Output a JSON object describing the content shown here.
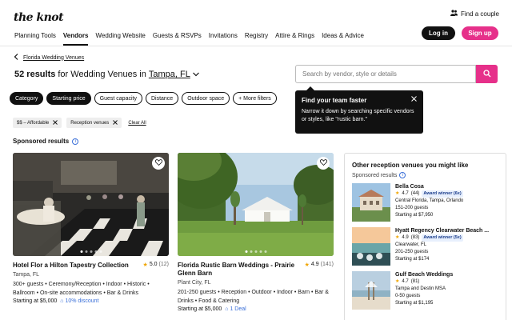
{
  "header": {
    "logo": "the knot",
    "find_couple": "Find a couple",
    "login": "Log in",
    "signup": "Sign up",
    "nav": [
      "Planning Tools",
      "Vendors",
      "Wedding Website",
      "Guests & RSVPs",
      "Invitations",
      "Registry",
      "Attire & Rings",
      "Ideas & Advice"
    ],
    "active_nav": "Vendors"
  },
  "breadcrumb": {
    "link": "Florida Wedding Venues"
  },
  "results": {
    "count": "52 results",
    "text": "for Wedding Venues in",
    "location": "Tampa, FL"
  },
  "search": {
    "placeholder": "Search by vendor, style or details"
  },
  "filters": [
    {
      "label": "Category",
      "dark": true
    },
    {
      "label": "Starting price",
      "dark": true
    },
    {
      "label": "Guest capacity",
      "dark": false
    },
    {
      "label": "Distance",
      "dark": false
    },
    {
      "label": "Outdoor space",
      "dark": false
    },
    {
      "label": "+ More filters",
      "dark": false
    }
  ],
  "applied": {
    "tags": [
      "$$ – Affordable",
      "Reception venues"
    ],
    "clear": "Clear All"
  },
  "tooltip": {
    "title": "Find your team faster",
    "body": "Narrow it down by searching specific vendors or styles, like \"rustic barn.\""
  },
  "sponsored": {
    "label": "Sponsored results"
  },
  "cards": [
    {
      "title": "Hotel Flor a Hilton Tapestry Collection",
      "rating": "5.0",
      "count": "(12)",
      "location": "Tampa, FL",
      "desc": "300+ guests • Ceremony/Reception • Indoor • Historic • Ballroom • On-site accommodations • Bar & Drinks",
      "price": "Starting at $5,000",
      "deal": "10% discount"
    },
    {
      "title": "Florida Rustic Barn Weddings - Prairie Glenn Barn",
      "rating": "4.9",
      "count": "(141)",
      "location": "Plant City, FL",
      "desc": "201-250 guests • Reception • Outdoor • Indoor • Barn • Bar & Drinks • Food & Catering",
      "price": "Starting at $5,000",
      "deal": "1 Deal"
    }
  ],
  "sidebar": {
    "title": "Other reception venues you might like",
    "sub": "Sponsored results",
    "items": [
      {
        "name": "Bella Cosa",
        "rating": "4.7",
        "count": "(44)",
        "badge": "Award winner (6x)",
        "loc": "Central Florida, Tampa, Orlando",
        "guests": "151-200 guests",
        "price": "Starting at $7,950"
      },
      {
        "name": "Hyatt Regency Clearwater Beach ...",
        "rating": "4.9",
        "count": "(83)",
        "badge": "Award winner (5x)",
        "loc": "Clearwater, FL",
        "guests": "201-250 guests",
        "price": "Starting at $174"
      },
      {
        "name": "Gulf Beach Weddings",
        "rating": "4.7",
        "count": "(81)",
        "badge": "",
        "loc": "Tampa and Destin MSA",
        "guests": "0-50 guests",
        "price": "Starting at $1,195"
      }
    ]
  },
  "colors": {
    "brand_pink": "#e6308a",
    "accent_blue": "#3a6fd8",
    "dark": "#111111"
  }
}
